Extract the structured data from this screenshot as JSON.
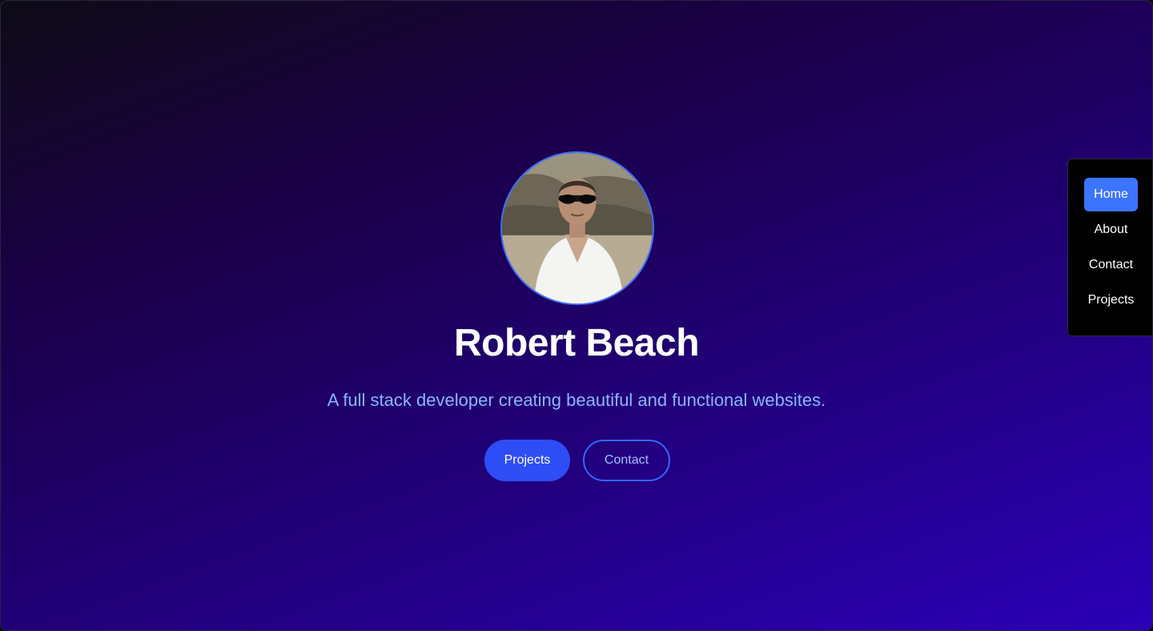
{
  "profile": {
    "name": "Robert Beach",
    "tagline": "A full stack developer creating beautiful and functional websites.",
    "photo_icon": "profile-photo"
  },
  "actions": {
    "projects_label": "Projects",
    "contact_label": "Contact"
  },
  "nav": {
    "items": [
      {
        "label": "Home",
        "active": true
      },
      {
        "label": "About",
        "active": false
      },
      {
        "label": "Contact",
        "active": false
      },
      {
        "label": "Projects",
        "active": false
      }
    ]
  },
  "colors": {
    "accent": "#3b74ff",
    "primary_button": "#2e4df5",
    "tagline": "#8fb2ff",
    "background_end": "#2b00b8"
  }
}
